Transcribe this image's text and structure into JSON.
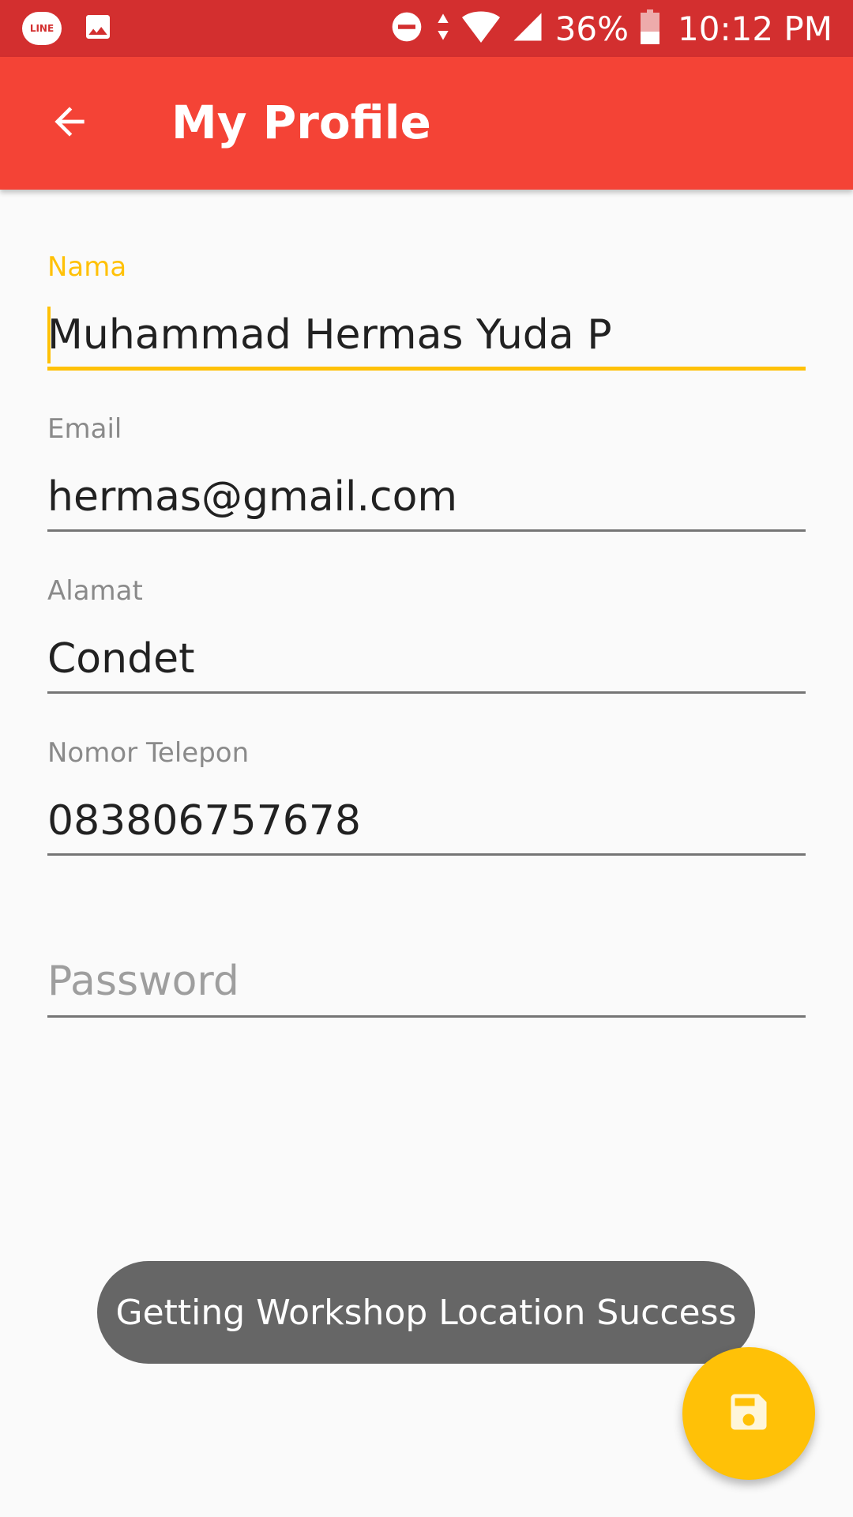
{
  "status_bar": {
    "line_app_label": "LINE",
    "battery": "36%",
    "time": "10:12 PM",
    "icons": [
      "line-app-icon",
      "image-icon",
      "do-not-disturb-icon",
      "data-arrows-icon",
      "wifi-icon",
      "signal-icon",
      "battery-icon"
    ]
  },
  "app_bar": {
    "title": "My Profile",
    "back_icon": "arrow-back-icon"
  },
  "form": {
    "nama": {
      "label": "Nama",
      "value": "Muhammad Hermas Yuda P"
    },
    "email": {
      "label": "Email",
      "value": "hermas@gmail.com"
    },
    "alamat": {
      "label": "Alamat",
      "value": "Condet"
    },
    "telepon": {
      "label": "Nomor Telepon",
      "value": "083806757678"
    },
    "password": {
      "placeholder": "Password",
      "value": ""
    }
  },
  "toast": {
    "message": "Getting Workshop Location Success"
  },
  "fab": {
    "icon": "save-icon"
  },
  "colors": {
    "status_bar": "#d32f2f",
    "app_bar": "#f44336",
    "accent": "#ffc107",
    "background": "#fafafa",
    "toast": "#666666"
  }
}
